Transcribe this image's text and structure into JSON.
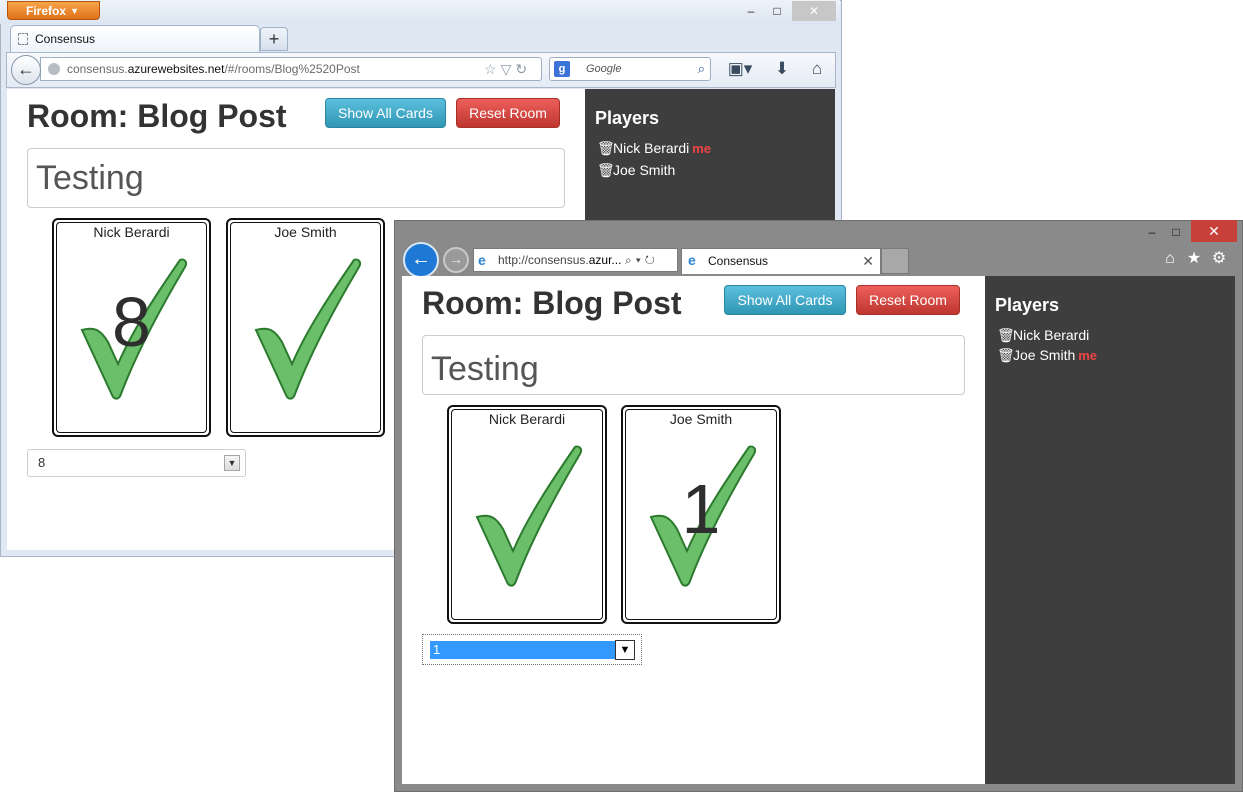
{
  "firefox": {
    "menu_button": "Firefox",
    "window_controls": [
      "–",
      "□",
      "✕"
    ],
    "tab_title": "Consensus",
    "new_tab": "+",
    "url_prefix": "consensus.",
    "url_host": "azurewebsites.net",
    "url_path": "/#/rooms/Blog%2520Post",
    "search_engine": "g",
    "search_placeholder": "Google"
  },
  "ie": {
    "url_prefix": "http://consensus.",
    "url_bold": "azur...",
    "tab_title": "Consensus",
    "tab_close": "✕",
    "window_controls": [
      "–",
      "□",
      "✕"
    ]
  },
  "room_ff": {
    "title": "Room: Blog Post",
    "show_all_label": "Show All Cards",
    "reset_label": "Reset Room",
    "topic": "Testing",
    "cards": [
      {
        "player": "Nick Berardi",
        "value": "8",
        "revealed": true
      },
      {
        "player": "Joe Smith",
        "value": "",
        "revealed": false
      }
    ],
    "selected_value": "8",
    "players_heading": "Players",
    "players": [
      {
        "name": "Nick Berardi",
        "tag": "me"
      },
      {
        "name": "Joe Smith",
        "tag": ""
      }
    ]
  },
  "room_ie": {
    "title": "Room: Blog Post",
    "show_all_label": "Show All Cards",
    "reset_label": "Reset Room",
    "topic": "Testing",
    "cards": [
      {
        "player": "Nick Berardi",
        "value": "",
        "revealed": false
      },
      {
        "player": "Joe Smith",
        "value": "1",
        "revealed": true
      }
    ],
    "selected_value": "1",
    "players_heading": "Players",
    "players": [
      {
        "name": "Nick Berardi",
        "tag": ""
      },
      {
        "name": "Joe Smith",
        "tag": "me"
      }
    ]
  },
  "colors": {
    "check_fill": "#6cbf6a",
    "check_stroke": "#2b7a2e",
    "sidebar_bg": "#3e3e3e",
    "me_tag": "#ee4444",
    "info_btn": "#49afcd",
    "danger_btn": "#da4f49"
  },
  "icons": {
    "player": "trash-icon",
    "card_mark": "checkmark-icon"
  }
}
